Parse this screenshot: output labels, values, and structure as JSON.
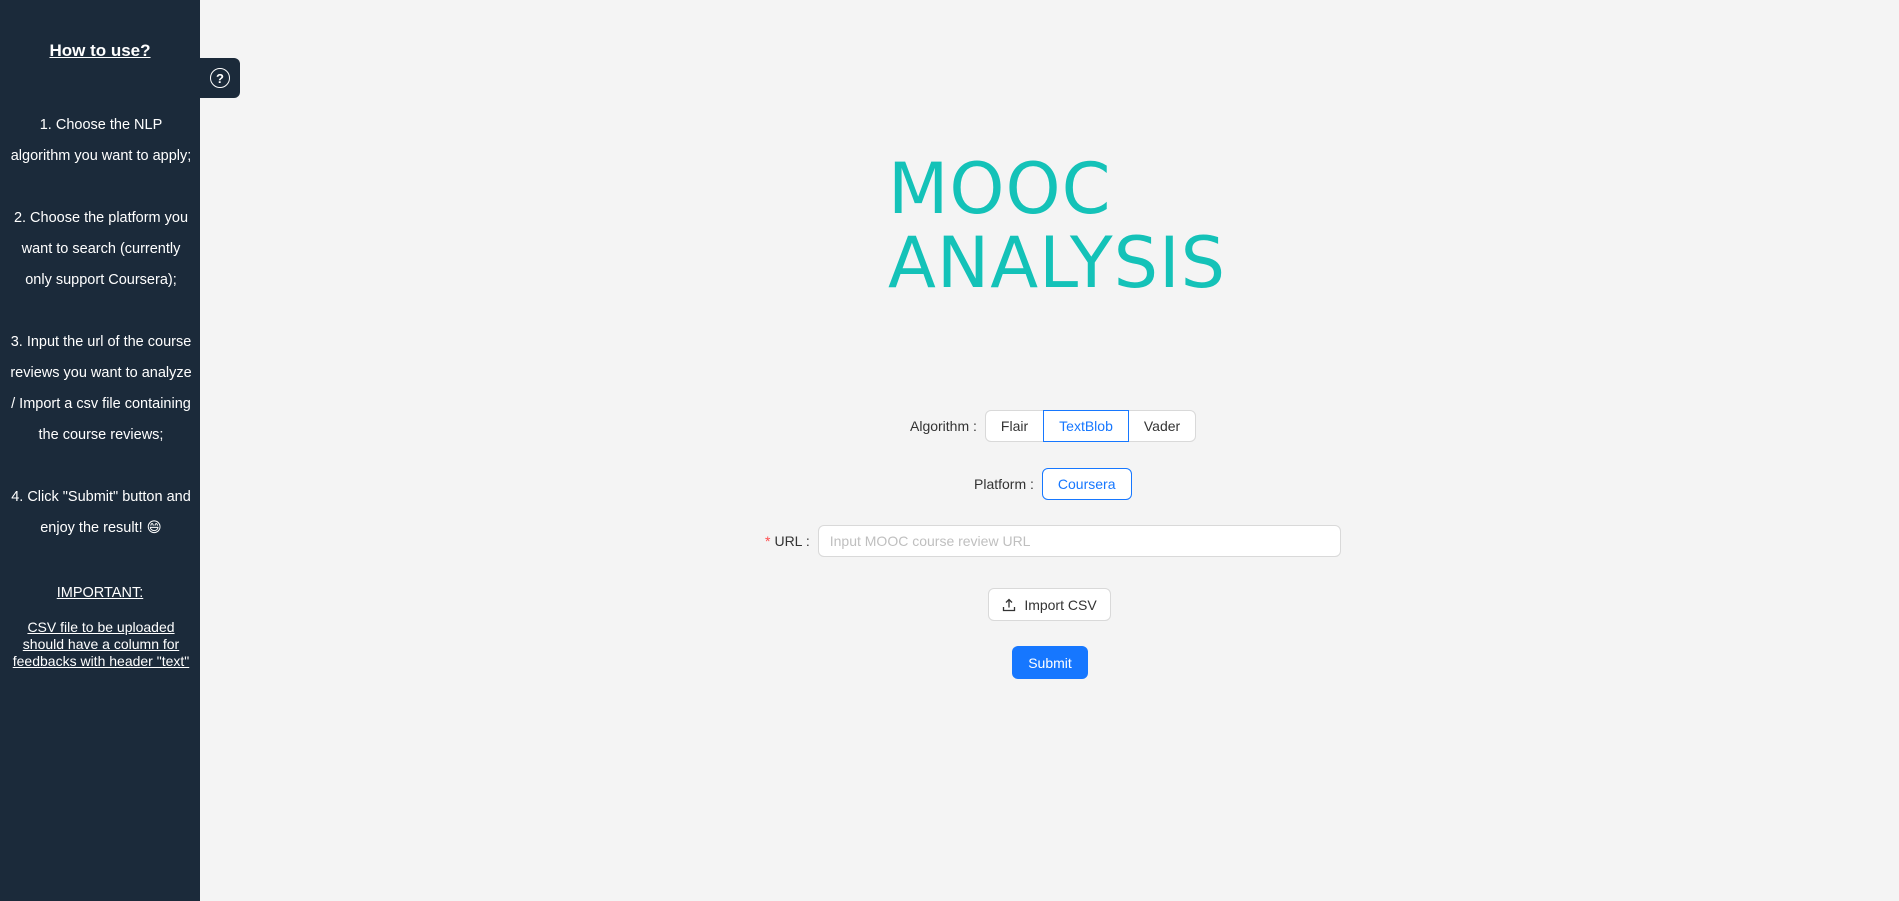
{
  "sidebar": {
    "title": "How to use?",
    "steps": [
      "1. Choose the NLP algorithm you want to apply;",
      "2. Choose the platform you want to search (currently only support Coursera);",
      "3. Input the url of the course reviews you want to analyze / Import a csv file containing the course reviews;",
      "4. Click \"Submit\" button and enjoy the result! 😄"
    ],
    "important_title": "IMPORTANT:",
    "important_text": "CSV file to be uploaded should have a column for feedbacks with header \"text\"",
    "help_icon": "question-circle-icon"
  },
  "logo": {
    "line1": "MOOC",
    "line2": "ANALYSIS",
    "color": "#14c2b8"
  },
  "form": {
    "algorithm": {
      "label": "Algorithm",
      "options": [
        "Flair",
        "TextBlob",
        "Vader"
      ],
      "selected": "TextBlob"
    },
    "platform": {
      "label": "Platform",
      "options": [
        "Coursera"
      ],
      "selected": "Coursera"
    },
    "url": {
      "label": "URL",
      "required_mark": "*",
      "placeholder": "Input MOOC course review URL",
      "value": ""
    },
    "import_label": "Import CSV",
    "import_icon": "upload-icon",
    "submit_label": "Submit"
  },
  "colors": {
    "sidebar_bg": "#1b2a3a",
    "accent": "#1677ff",
    "background": "#f4f4f4"
  }
}
